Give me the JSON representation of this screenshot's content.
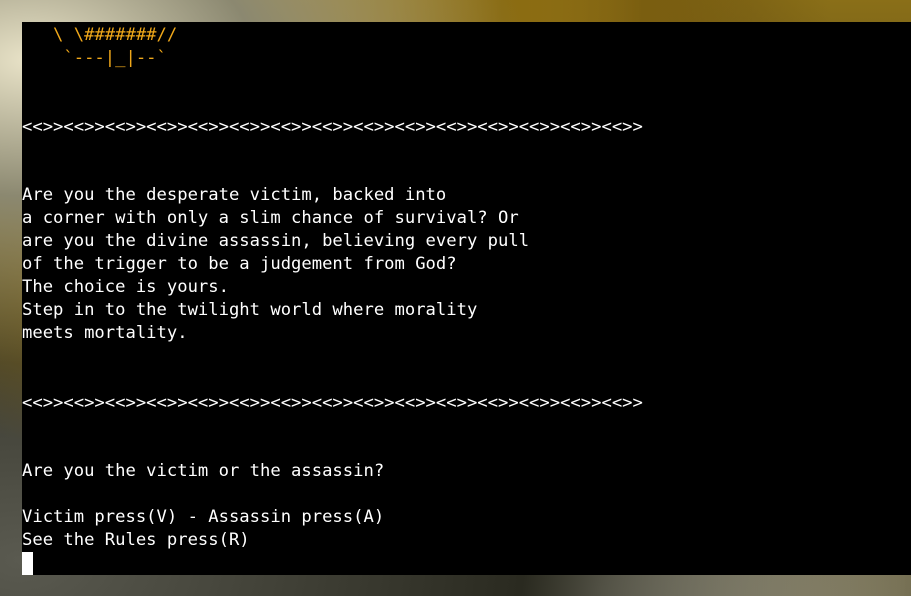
{
  "ascii_art": {
    "line1": "   \\ \\#######//",
    "line2": "    `---|_|--`"
  },
  "divider_top": "<<>><<>><<>><<>><<>><<>><<>><<>><<>><<>><<>><<>><<>><<>><<>>",
  "intro": {
    "line1": "Are you the desperate victim, backed into",
    "line2": "a corner with only a slim chance of survival? Or",
    "line3": "are you the divine assassin, believing every pull",
    "line4": "of the trigger to be a judgement from God?",
    "line5": "The choice is yours.",
    "line6": "Step in to the twilight world where morality",
    "line7": "meets mortality."
  },
  "divider_bottom": "<<>><<>><<>><<>><<>><<>><<>><<>><<>><<>><<>><<>><<>><<>><<>>",
  "prompt": {
    "question": "Are you the victim or the assassin?",
    "choice_roles": "Victim press(V) - Assassin press(A)",
    "choice_rules": "See the Rules press(R)"
  },
  "colors": {
    "terminal_bg": "#000000",
    "text": "#ffffff",
    "ascii_art": "#f0a81a"
  }
}
